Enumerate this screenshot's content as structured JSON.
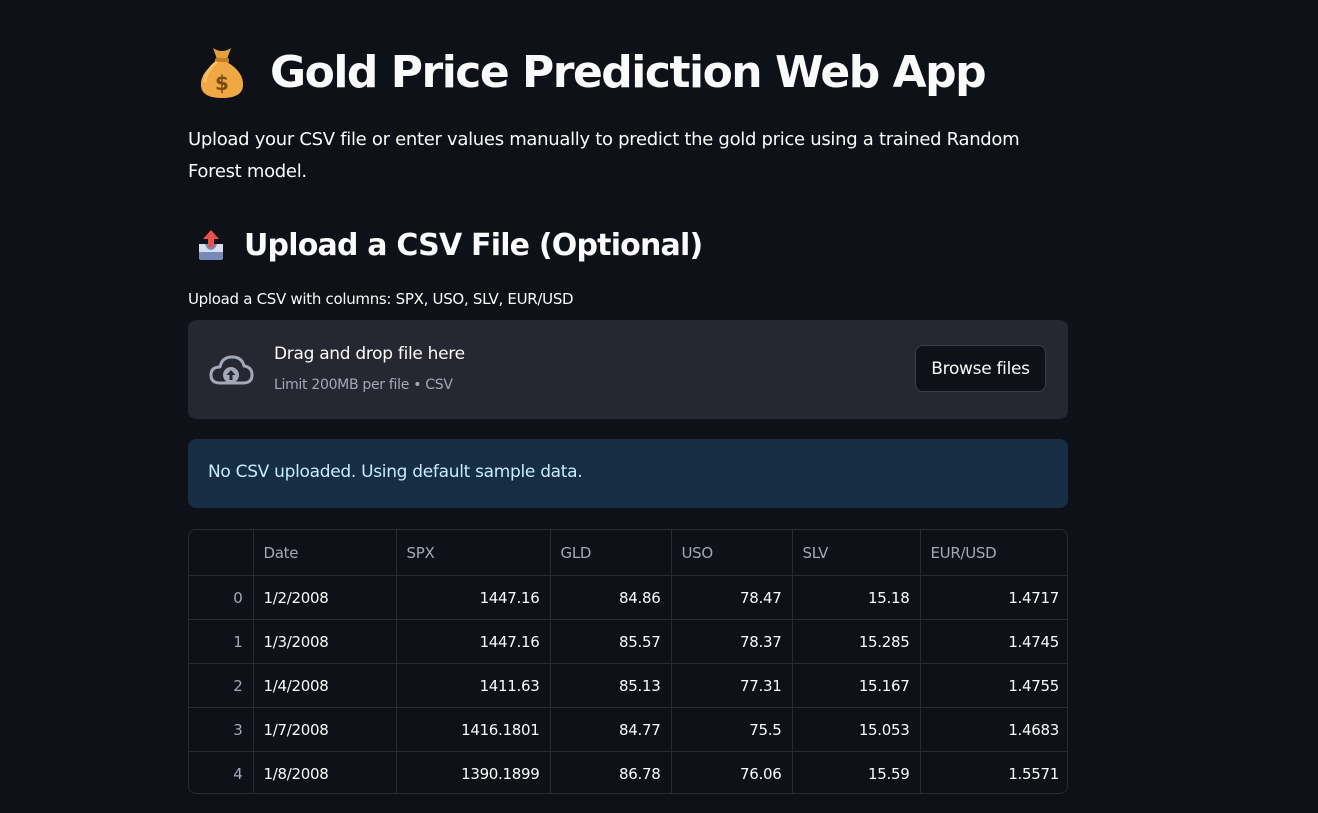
{
  "title": {
    "text": "Gold Price Prediction Web App",
    "icon": "money-bag-icon"
  },
  "intro": "Upload your CSV file or enter values manually to predict the gold price using a trained Random Forest model.",
  "upload_section": {
    "heading": "Upload a CSV File (Optional)",
    "icon": "outbox-tray-icon",
    "label": "Upload a CSV with columns: SPX, USO, SLV, EUR/USD",
    "dropzone_text": "Drag and drop file here",
    "dropzone_hint": "Limit 200MB per file • CSV",
    "browse_label": "Browse files"
  },
  "info_message": "No CSV uploaded. Using default sample data.",
  "table": {
    "columns": [
      "",
      "Date",
      "SPX",
      "GLD",
      "USO",
      "SLV",
      "EUR/USD"
    ],
    "rows": [
      [
        "0",
        "1/2/2008",
        "1447.16",
        "84.86",
        "78.47",
        "15.18",
        "1.4717"
      ],
      [
        "1",
        "1/3/2008",
        "1447.16",
        "85.57",
        "78.37",
        "15.285",
        "1.4745"
      ],
      [
        "2",
        "1/4/2008",
        "1411.63",
        "85.13",
        "77.31",
        "15.167",
        "1.4755"
      ],
      [
        "3",
        "1/7/2008",
        "1416.1801",
        "84.77",
        "75.5",
        "15.053",
        "1.4683"
      ],
      [
        "4",
        "1/8/2008",
        "1390.1899",
        "86.78",
        "76.06",
        "15.59",
        "1.5571"
      ]
    ]
  },
  "colors": {
    "background": "#0e1117",
    "panel": "#262730",
    "info_bg": "#172d43",
    "info_text": "#c7ebff",
    "text": "#fafafa",
    "muted": "#a3a8b8"
  }
}
